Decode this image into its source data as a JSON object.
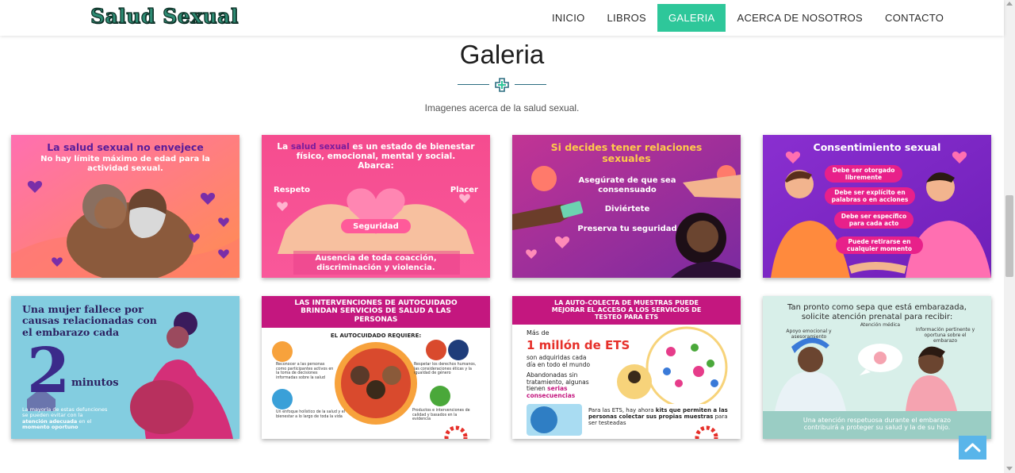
{
  "header": {
    "logo": "Salud Sexual",
    "nav": [
      {
        "label": "INICIO"
      },
      {
        "label": "LIBROS"
      },
      {
        "label": "GALERIA",
        "active": true
      },
      {
        "label": "ACERCA DE NOSOTROS"
      },
      {
        "label": "CONTACTO"
      }
    ]
  },
  "section": {
    "title": "Galeria",
    "subtitle": "Imagenes acerca de la salud sexual."
  },
  "gallery": [
    {
      "title": "La salud sexual no envejece",
      "subtitle": "No hay límite máximo de edad para la actividad sexual."
    },
    {
      "line1_pre": "La ",
      "line1_highlight": "salud sexual",
      "line1_post": " es un estado de bienestar",
      "line2": "físico, emocional, mental y social.",
      "line3": "Abarca:",
      "left": "Respeto",
      "right": "Placer",
      "center": "Seguridad",
      "bottom": "Ausencia de toda coacción, discriminación y violencia."
    },
    {
      "title": "Si decides tener relaciones sexuales",
      "items": [
        "Asegúrate de que sea consensuado",
        "Diviértete",
        "Preserva tu seguridad"
      ]
    },
    {
      "title": "Consentimiento sexual",
      "bubbles": [
        "Debe ser otorgado libremente",
        "Debe ser explícito en palabras o en acciones",
        "Debe ser específico para cada acto",
        "Puede retirarse en cualquier momento"
      ]
    },
    {
      "headline": "Una mujer fallece por causas relacionadas con el embarazo cada",
      "number": "2",
      "unit": "minutos",
      "footnote_1": "La mayoría de estas defunciones se pueden evitar con la",
      "footnote_bold": "atención adecuada",
      "footnote_2": "en el",
      "footnote_bold_2": "momento oportuno"
    },
    {
      "title": "LAS INTERVENCIONES DE AUTOCUIDADO BRINDAN SERVICIOS DE SALUD A LAS PERSONAS",
      "subtitle": "EL AUTOCUIDADO REQUIERE:",
      "points": [
        "Reconocer a las personas como participantes activos en la toma de decisiones informadas sobre la salud",
        "Respetar los derechos humanos, las consideraciones éticas y la igualdad de género",
        "Un enfoque holístico de la salud y el bienestar a lo largo de toda la vida",
        "Productos e intervenciones de calidad y basados en la evidencia"
      ]
    },
    {
      "title": "LA AUTO-COLECTA DE MUESTRAS PUEDE MEJORAR EL ACCESO A LOS SERVICIOS DE TESTEO PARA ETS",
      "pre": "Más de",
      "big": "1 millón de ETS",
      "text1": "son adquiridas cada día en todo el mundo",
      "text2": "Abandonadas sin tratamiento, algunas tienen",
      "text2_bold": "serias consecuencias",
      "bottom_1": "Para las ETS, hay ahora",
      "bottom_bold": "kits que permiten a las personas colectar sus propias muestras",
      "bottom_2": "para ser testeadas"
    },
    {
      "title": "Tan pronto como sepa que está embarazada, solicite atención prenatal para recibir:",
      "items": [
        "Apoyo emocional y asesoramiento",
        "Atención médica",
        "Información pertinente y oportuna sobre el embarazo"
      ],
      "bottom": "Una atención respetuosa durante el embarazo contribuirá a proteger su salud y la de su hijo."
    }
  ],
  "colors": {
    "accent": "#2ec79a",
    "back_to_top": "#59b5ea"
  },
  "icons": {
    "divider": "medical-cross-icon",
    "back_to_top": "chevron-up-icon"
  }
}
